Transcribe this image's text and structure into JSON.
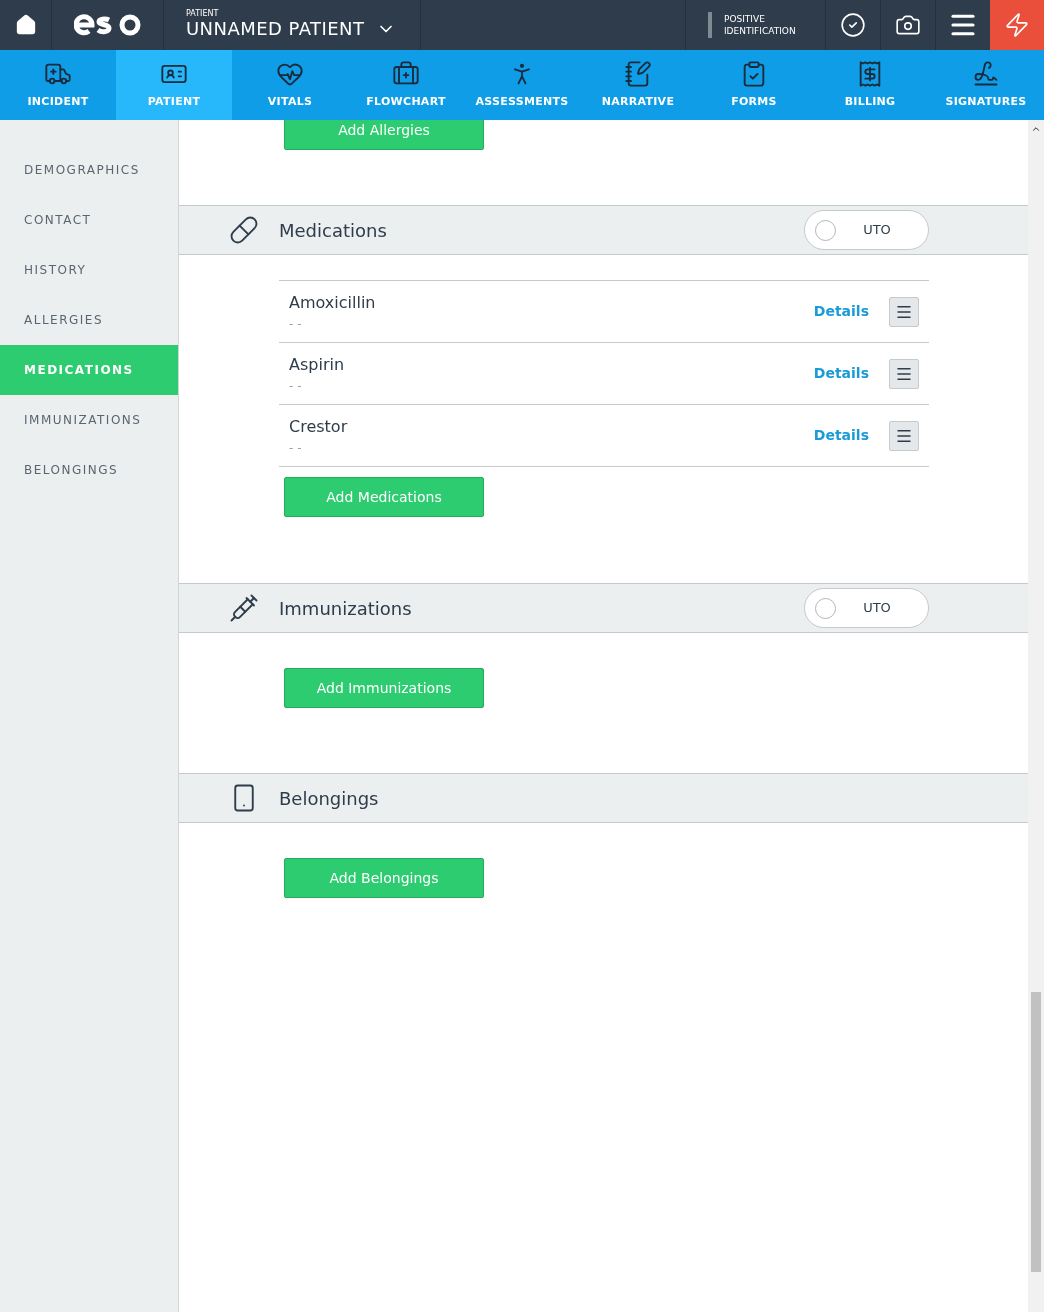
{
  "header": {
    "patient_label": "PATIENT",
    "patient_name": "UNNAMED PATIENT",
    "identification": "POSITIVE IDENTIFICATION"
  },
  "nav_tabs": [
    {
      "label": "INCIDENT",
      "selected": false
    },
    {
      "label": "PATIENT",
      "selected": true
    },
    {
      "label": "VITALS",
      "selected": false
    },
    {
      "label": "FLOWCHART",
      "selected": false
    },
    {
      "label": "ASSESSMENTS",
      "selected": false
    },
    {
      "label": "NARRATIVE",
      "selected": false
    },
    {
      "label": "FORMS",
      "selected": false
    },
    {
      "label": "BILLING",
      "selected": false
    },
    {
      "label": "SIGNATURES",
      "selected": false
    }
  ],
  "sidebar": {
    "items": [
      {
        "label": "DEMOGRAPHICS",
        "selected": false
      },
      {
        "label": "CONTACT",
        "selected": false
      },
      {
        "label": "HISTORY",
        "selected": false
      },
      {
        "label": "ALLERGIES",
        "selected": false
      },
      {
        "label": "MEDICATIONS",
        "selected": true
      },
      {
        "label": "IMMUNIZATIONS",
        "selected": false
      },
      {
        "label": "BELONGINGS",
        "selected": false
      }
    ]
  },
  "top_button": "Add Allergies",
  "sections": [
    {
      "kind": "medications",
      "title": "Medications",
      "uto": {
        "label": "UTO",
        "on": false
      },
      "items": [
        {
          "name": "Amoxicillin",
          "detail": "- -",
          "link": "Details"
        },
        {
          "name": "Aspirin",
          "detail": "- -",
          "link": "Details"
        },
        {
          "name": "Crestor",
          "detail": "- -",
          "link": "Details"
        }
      ],
      "button": "Add Medications"
    },
    {
      "kind": "immunizations",
      "title": "Immunizations",
      "uto": {
        "label": "UTO",
        "on": false
      },
      "button": "Add Immunizations"
    },
    {
      "kind": "belongings",
      "title": "Belongings",
      "button": "Add Belongings"
    }
  ]
}
